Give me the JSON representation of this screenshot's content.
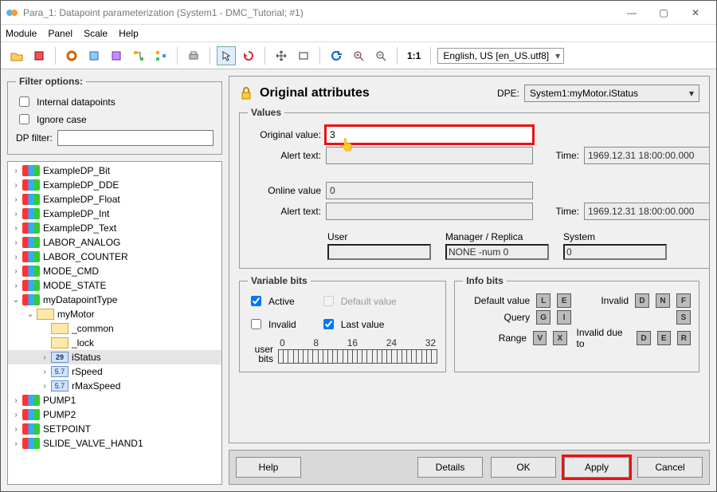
{
  "window": {
    "title": "Para_1: Datapoint parameterization (System1 - DMC_Tutorial; #1)"
  },
  "menubar": {
    "items": [
      "Module",
      "Panel",
      "Scale",
      "Help"
    ]
  },
  "toolbar": {
    "scale_label": "1:1",
    "language": "English, US [en_US.utf8]"
  },
  "filter": {
    "legend": "Filter options:",
    "internal_dp": "Internal datapoints",
    "ignore_case": "Ignore case",
    "dp_filter_label": "DP filter:",
    "dp_filter_value": ""
  },
  "tree": [
    {
      "d": 0,
      "tw": ">",
      "type": "dp",
      "label": "ExampleDP_Bit"
    },
    {
      "d": 0,
      "tw": ">",
      "type": "dp",
      "label": "ExampleDP_DDE"
    },
    {
      "d": 0,
      "tw": ">",
      "type": "dp",
      "label": "ExampleDP_Float"
    },
    {
      "d": 0,
      "tw": ">",
      "type": "dp",
      "label": "ExampleDP_Int"
    },
    {
      "d": 0,
      "tw": ">",
      "type": "dp",
      "label": "ExampleDP_Text"
    },
    {
      "d": 0,
      "tw": ">",
      "type": "dp",
      "label": "LABOR_ANALOG"
    },
    {
      "d": 0,
      "tw": ">",
      "type": "dp",
      "label": "LABOR_COUNTER"
    },
    {
      "d": 0,
      "tw": ">",
      "type": "dp",
      "label": "MODE_CMD"
    },
    {
      "d": 0,
      "tw": ">",
      "type": "dp",
      "label": "MODE_STATE"
    },
    {
      "d": 0,
      "tw": "v",
      "type": "dp",
      "label": "myDatapointType"
    },
    {
      "d": 1,
      "tw": "v",
      "type": "folder",
      "label": "myMotor"
    },
    {
      "d": 2,
      "tw": " ",
      "type": "folder",
      "label": "_common"
    },
    {
      "d": 2,
      "tw": " ",
      "type": "folder",
      "label": "_lock"
    },
    {
      "d": 2,
      "tw": ">",
      "type": "num",
      "label": "iStatus",
      "selected": true,
      "badge": "29"
    },
    {
      "d": 2,
      "tw": ">",
      "type": "float",
      "label": "rSpeed",
      "badge": "5.7"
    },
    {
      "d": 2,
      "tw": ">",
      "type": "float",
      "label": "rMaxSpeed",
      "badge": "5.7"
    },
    {
      "d": 0,
      "tw": ">",
      "type": "dp",
      "label": "PUMP1"
    },
    {
      "d": 0,
      "tw": ">",
      "type": "dp",
      "label": "PUMP2"
    },
    {
      "d": 0,
      "tw": ">",
      "type": "dp",
      "label": "SETPOINT"
    },
    {
      "d": 0,
      "tw": ">",
      "type": "dp",
      "label": "SLIDE_VALVE_HAND1"
    }
  ],
  "attrs": {
    "title": "Original attributes",
    "dpe_label": "DPE:",
    "dpe_value": "System1:myMotor.iStatus",
    "values": {
      "legend": "Values",
      "original_value_label": "Original value:",
      "original_value": "3",
      "alert_text_label": "Alert text:",
      "alert_text_1": "",
      "online_value_label": "Online value",
      "online_value": "0",
      "alert_text_2": "",
      "time_label": "Time:",
      "time_1": "1969.12.31 18:00:00.000",
      "time_2": "1969.12.31 18:00:00.000",
      "user_label": "User",
      "user_value": "",
      "manager_label": "Manager / Replica",
      "manager_value": "NONE -num 0",
      "system_label": "System",
      "system_value": "0"
    },
    "vbits": {
      "legend": "Variable bits",
      "active": "Active",
      "invalid": "Invalid",
      "default_value": "Default value",
      "last_value": "Last value",
      "user_bits_label_1": "user",
      "user_bits_label_2": "bits",
      "ticks": [
        "0",
        "8",
        "16",
        "24",
        "32"
      ]
    },
    "ibits": {
      "legend": "Info bits",
      "default_value_label": "Default value",
      "query_label": "Query",
      "range_label": "Range",
      "invalid_label": "Invalid",
      "invalid_due_label": "Invalid due to",
      "sq": {
        "L": "L",
        "E": "E",
        "G": "G",
        "I": "I",
        "V": "V",
        "X": "X",
        "D": "D",
        "N": "N",
        "F": "F",
        "S": "S",
        "D2": "D",
        "E2": "E",
        "R": "R"
      }
    },
    "buttons": {
      "help": "Help",
      "details": "Details",
      "ok": "OK",
      "apply": "Apply",
      "cancel": "Cancel"
    }
  }
}
